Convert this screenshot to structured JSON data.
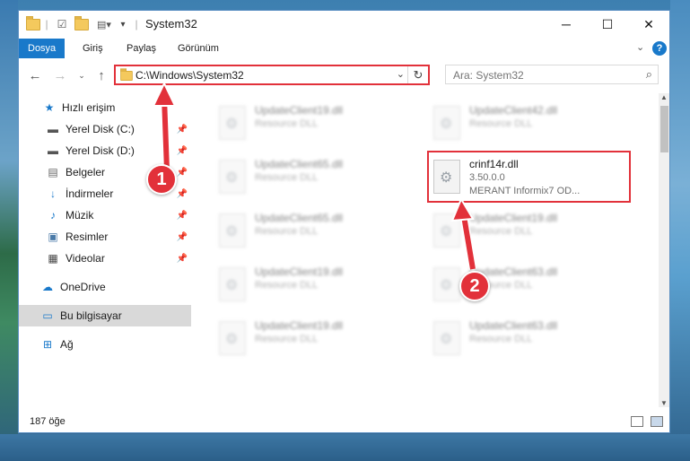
{
  "window": {
    "title": "System32",
    "minimize_glyph": "─",
    "maximize_glyph": "☐",
    "close_glyph": "✕"
  },
  "ribbon": {
    "tabs": [
      "Dosya",
      "Giriş",
      "Paylaş",
      "Görünüm"
    ],
    "active_tab": "Dosya",
    "accent_color": "#1979ca"
  },
  "navbar": {
    "address": "C:\\Windows\\System32",
    "search_placeholder": "Ara: System32"
  },
  "sidebar": {
    "quick_access": "Hızlı erişim",
    "items": [
      {
        "label": "Yerel Disk (C:)",
        "icon": "drive-icon",
        "pinned": true
      },
      {
        "label": "Yerel Disk (D:)",
        "icon": "drive-icon",
        "pinned": true
      },
      {
        "label": "Belgeler",
        "icon": "documents-icon",
        "pinned": true
      },
      {
        "label": "İndirmeler",
        "icon": "download-icon",
        "pinned": true
      },
      {
        "label": "Müzik",
        "icon": "music-icon",
        "pinned": true
      },
      {
        "label": "Resimler",
        "icon": "pictures-icon",
        "pinned": true
      },
      {
        "label": "Videolar",
        "icon": "videos-icon",
        "pinned": true
      }
    ],
    "onedrive": "OneDrive",
    "this_pc": "Bu bilgisayar",
    "network": "Ağ"
  },
  "files": [
    {
      "name": "UpdateClient19.dll",
      "sub1": "Resource DLL",
      "sub2": ""
    },
    {
      "name": "UpdateClient42.dll",
      "sub1": "Resource DLL",
      "sub2": ""
    },
    {
      "name": "UpdateClient65.dll",
      "sub1": "Resource DLL",
      "sub2": ""
    },
    {
      "name": "crinf14r.dll",
      "sub1": "3.50.0.0",
      "sub2": "MERANT Informix7 OD..."
    },
    {
      "name": "UpdateClient65.dll",
      "sub1": "Resource DLL",
      "sub2": ""
    },
    {
      "name": "UpdateClient19.dll",
      "sub1": "Resource DLL",
      "sub2": ""
    },
    {
      "name": "UpdateClient19.dll",
      "sub1": "Resource DLL",
      "sub2": ""
    },
    {
      "name": "UpdateClient63.dll",
      "sub1": "Resource DLL",
      "sub2": ""
    },
    {
      "name": "UpdateClient19.dll",
      "sub1": "Resource DLL",
      "sub2": ""
    },
    {
      "name": "UpdateClient63.dll",
      "sub1": "Resource DLL",
      "sub2": ""
    }
  ],
  "status": {
    "item_count": "187 öğe"
  },
  "annotations": {
    "step1": "1",
    "step2": "2",
    "highlight_color": "#e2313a"
  }
}
